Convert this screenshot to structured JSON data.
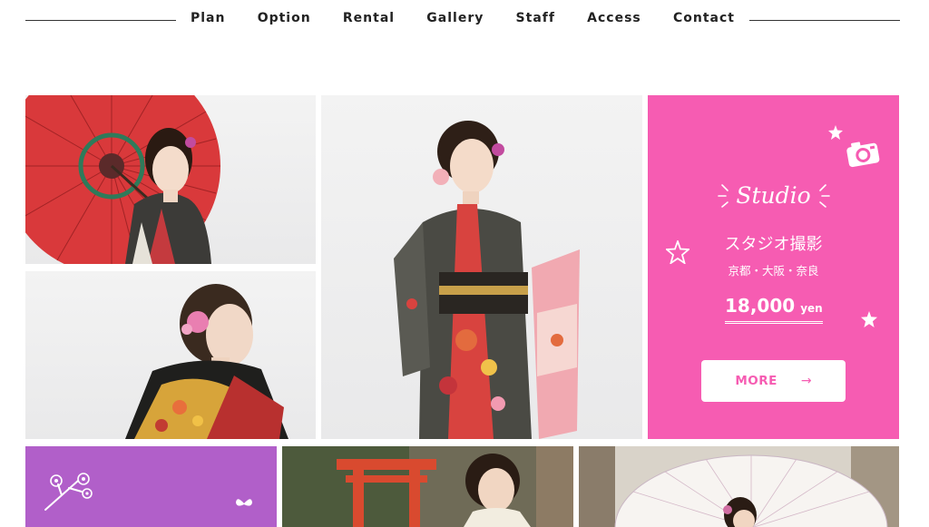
{
  "nav": {
    "items": [
      {
        "label": "Plan"
      },
      {
        "label": "Option"
      },
      {
        "label": "Rental"
      },
      {
        "label": "Gallery"
      },
      {
        "label": "Staff"
      },
      {
        "label": "Access"
      },
      {
        "label": "Contact"
      }
    ]
  },
  "studio_card": {
    "script_label": "Studio",
    "title": "スタジオ撮影",
    "locations": "京都・大阪・奈良",
    "price": "18,000",
    "price_unit": "yen",
    "more_label": "MORE",
    "background_color": "#f65cb2"
  },
  "purple_card": {
    "background_color": "#b15fc9",
    "icons": [
      "plum-blossom-icon",
      "butterfly-icon"
    ]
  },
  "gallery": {
    "photos": [
      {
        "name": "kimono-woman-with-red-umbrella-photo"
      },
      {
        "name": "kimono-woman-back-view-photo"
      },
      {
        "name": "kimono-woman-full-length-photo"
      },
      {
        "name": "woman-at-shrine-photo"
      },
      {
        "name": "woman-with-parasol-photo"
      }
    ]
  }
}
